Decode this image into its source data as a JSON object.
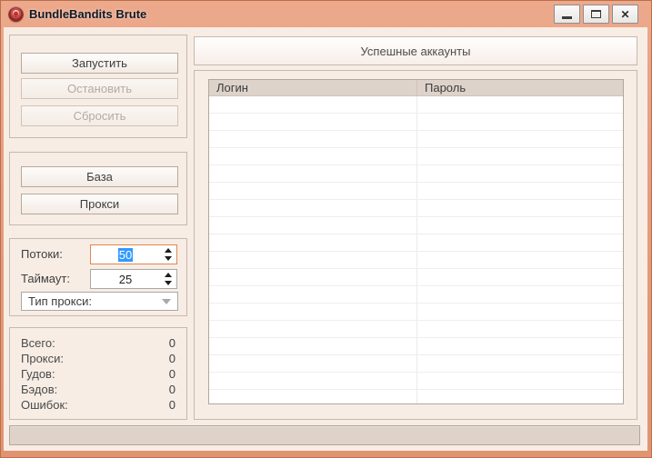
{
  "window": {
    "title": "BundleBandits Brute",
    "controls": {
      "minimize_icon": "minimize-icon",
      "maximize_icon": "maximize-icon",
      "close_icon": "close-icon",
      "close_glyph": "✕"
    }
  },
  "left_panel": {
    "run_controls": {
      "start": "Запустить",
      "stop": "Остановить",
      "reset": "Сбросить"
    },
    "sources": {
      "base": "База",
      "proxy": "Прокси"
    },
    "settings": {
      "threads_label": "Потоки:",
      "threads_value": "50",
      "timeout_label": "Таймаут:",
      "timeout_value": "25",
      "proxy_type_label": "Тип прокси:"
    },
    "stats": [
      {
        "label": "Всего:",
        "value": "0"
      },
      {
        "label": "Прокси:",
        "value": "0"
      },
      {
        "label": "Гудов:",
        "value": "0"
      },
      {
        "label": "Бэдов:",
        "value": "0"
      },
      {
        "label": "Ошибок:",
        "value": "0"
      }
    ]
  },
  "right_panel": {
    "header": "Успешные аккаунты",
    "table": {
      "columns": [
        "Логин",
        "Пароль"
      ],
      "rows": [],
      "visible_empty_rows": 18
    }
  },
  "status_bar": {
    "text": ""
  },
  "colors": {
    "titlebar": "#e59e80",
    "client_bg": "#f7ede5",
    "group_border": "#c6b9ad",
    "table_header_bg": "#ded3cb",
    "statusbar_bg": "#ded2c9",
    "selection": "#3399ff",
    "focus_border": "#e0884e"
  }
}
